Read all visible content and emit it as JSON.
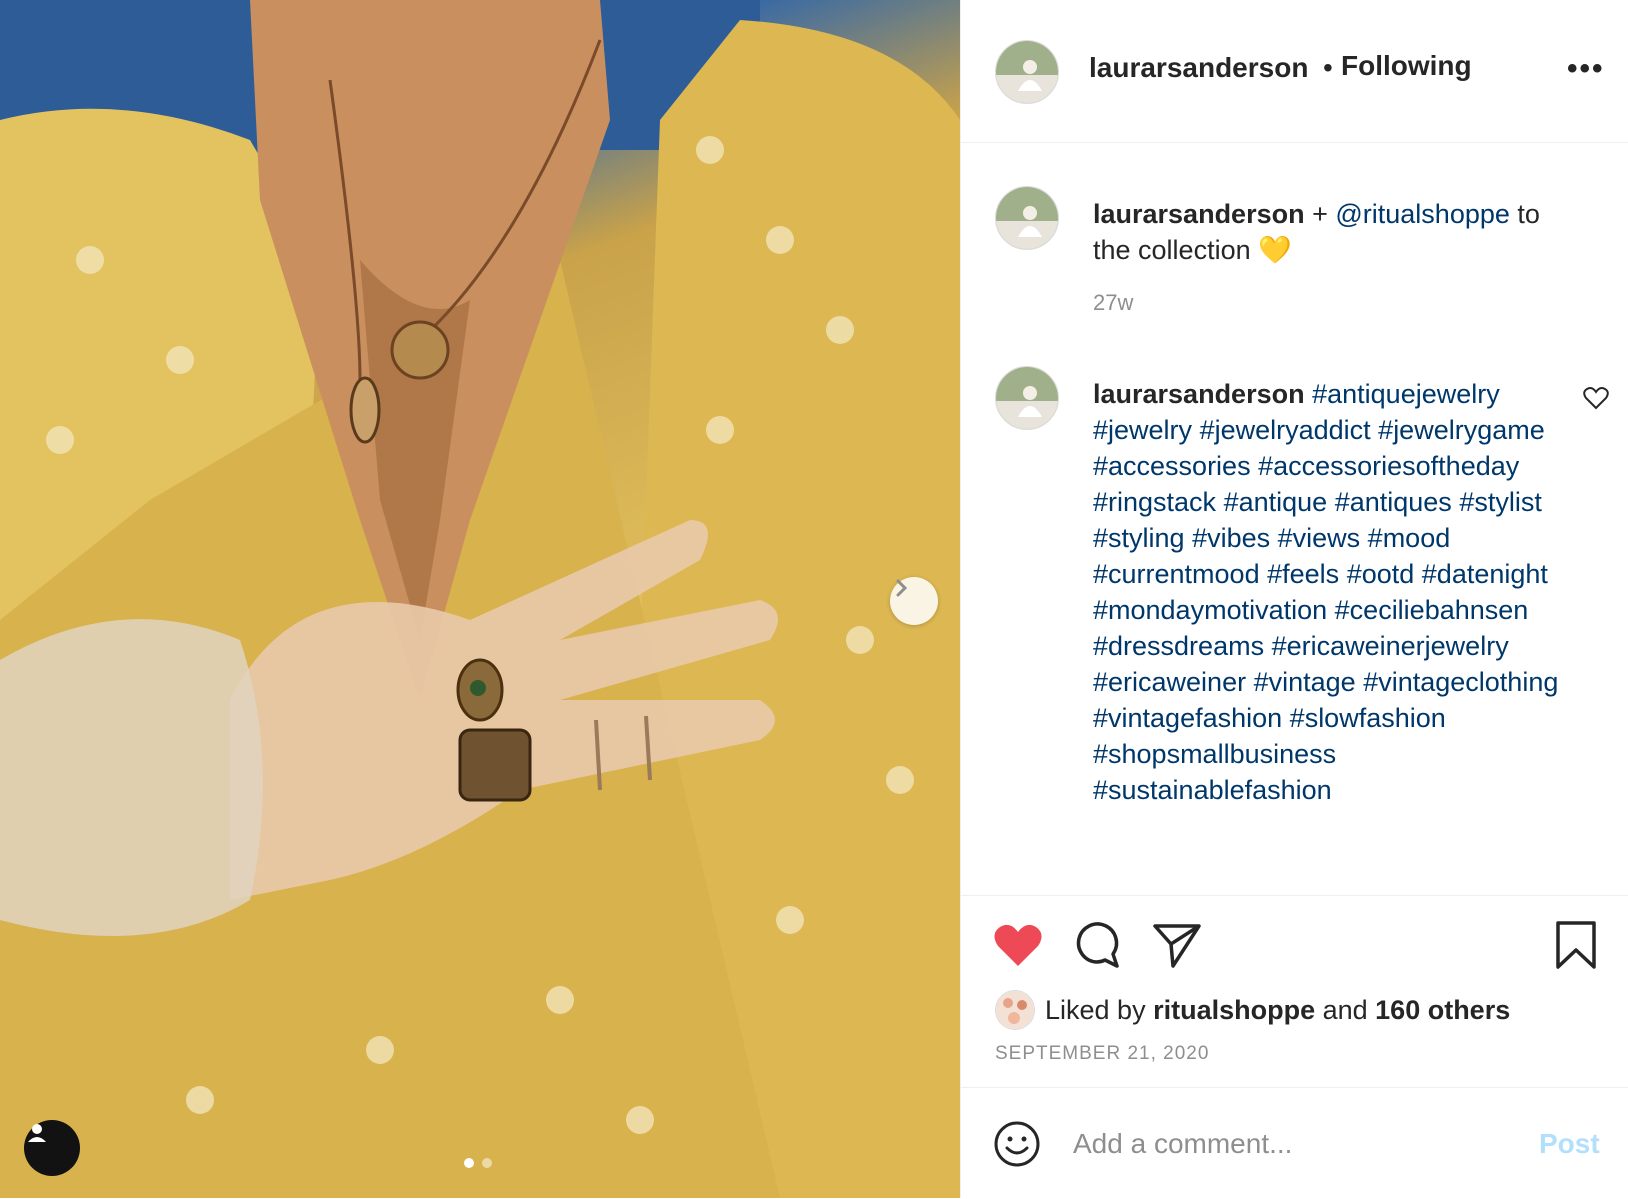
{
  "header": {
    "username": "laurarsanderson",
    "separator": "•",
    "follow_status": "Following",
    "more_label": "•••"
  },
  "caption": {
    "username": "laurarsanderson",
    "plus": " + ",
    "mention": "@ritualshoppe",
    "text_after": " to the collection ",
    "emoji": "💛",
    "time": "27w"
  },
  "hashtag_comment": {
    "username": "laurarsanderson",
    "hashtags": [
      "#antiquejewelry",
      "#jewelry",
      "#jewelryaddict",
      "#jewelrygame",
      "#accessories",
      "#accessoriesoftheday",
      "#ringstack",
      "#antique",
      "#antiques",
      "#stylist",
      "#styling",
      "#vibes",
      "#views",
      "#mood",
      "#currentmood",
      "#feels",
      "#ootd",
      "#datenight",
      "#mondaymotivation",
      "#ceciliebahnsen",
      "#dressdreams",
      "#ericaweinerjewelry",
      "#ericaweiner",
      "#vintage",
      "#vintageclothing",
      "#vintagefashion",
      "#slowfashion",
      "#shopsmallbusiness",
      "#sustainablefashion"
    ]
  },
  "likes": {
    "prefix": "Liked by ",
    "liker": "ritualshoppe",
    "and": " and ",
    "others": "160 others"
  },
  "date": "SEPTEMBER 21, 2020",
  "comment_box": {
    "placeholder": "Add a comment...",
    "post_label": "Post"
  },
  "carousel": {
    "count": 2,
    "active": 0
  },
  "colors": {
    "like_red": "#ed4956",
    "link_blue": "#00376b",
    "post_disabled": "#b2dffc",
    "muted": "#8e8e8e"
  },
  "icons": [
    "more-icon",
    "heart-outline-icon",
    "heart-filled-icon",
    "comment-icon",
    "share-icon",
    "bookmark-icon",
    "emoji-icon",
    "chevron-right-icon",
    "user-tag-icon"
  ]
}
